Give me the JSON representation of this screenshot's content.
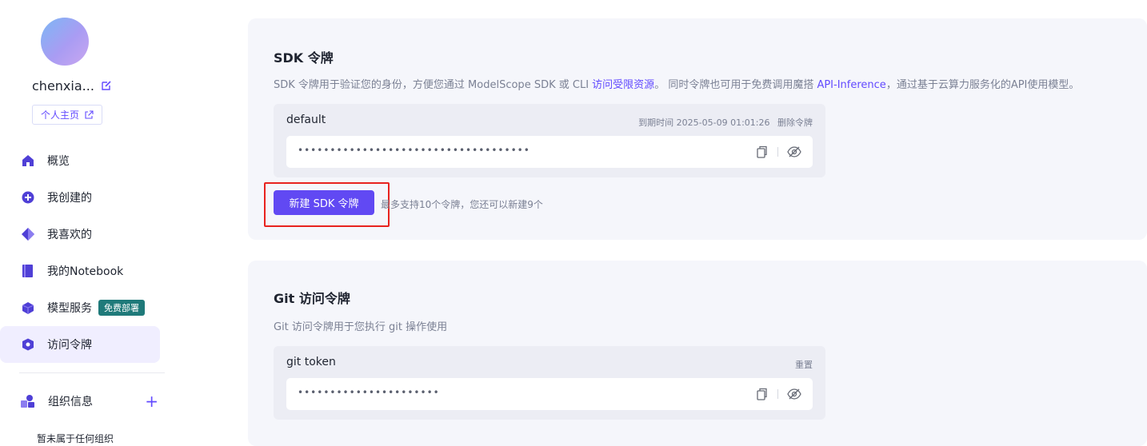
{
  "sidebar": {
    "username": "chenxia...",
    "profile_button": "个人主页",
    "nav": [
      {
        "label": "概览",
        "icon": "home-icon"
      },
      {
        "label": "我创建的",
        "icon": "plus-circle-icon"
      },
      {
        "label": "我喜欢的",
        "icon": "diamond-icon"
      },
      {
        "label": "我的Notebook",
        "icon": "notebook-icon"
      },
      {
        "label": "模型服务",
        "icon": "cube-icon",
        "badge": "免费部署"
      },
      {
        "label": "访问令牌",
        "icon": "shield-icon",
        "active": true
      }
    ],
    "org_label": "组织信息",
    "org_add": "+",
    "org_empty": "暂未属于任何组织"
  },
  "sdk_card": {
    "title": "SDK 令牌",
    "desc_prefix": "SDK 令牌用于验证您的身份，方便您通过 ModelScope SDK 或 CLI ",
    "desc_link1": "访问受限资源",
    "desc_middle": "。 同时令牌也可用于免费调用魔搭 ",
    "desc_link2": "API-Inference",
    "desc_suffix": "，通过基于云算力服务化的API使用模型。",
    "token_name": "default",
    "expire_label": "到期时间 2025-05-09 01:01:26",
    "delete_label": "删除令牌",
    "token_masked": "••••••••••••••••••••••••••••••••••••",
    "new_button": "新建 SDK 令牌",
    "limit_text": "最多支持10个令牌，您还可以新建9个"
  },
  "git_card": {
    "title": "Git 访问令牌",
    "desc": "Git 访问令牌用于您执行 git 操作使用",
    "token_name": "git token",
    "reset_label": "重置",
    "token_masked": "••••••••••••••••••••••"
  },
  "colors": {
    "accent": "#6149f3",
    "highlight_border": "#e8231f",
    "badge_bg": "#1f7a7a"
  }
}
